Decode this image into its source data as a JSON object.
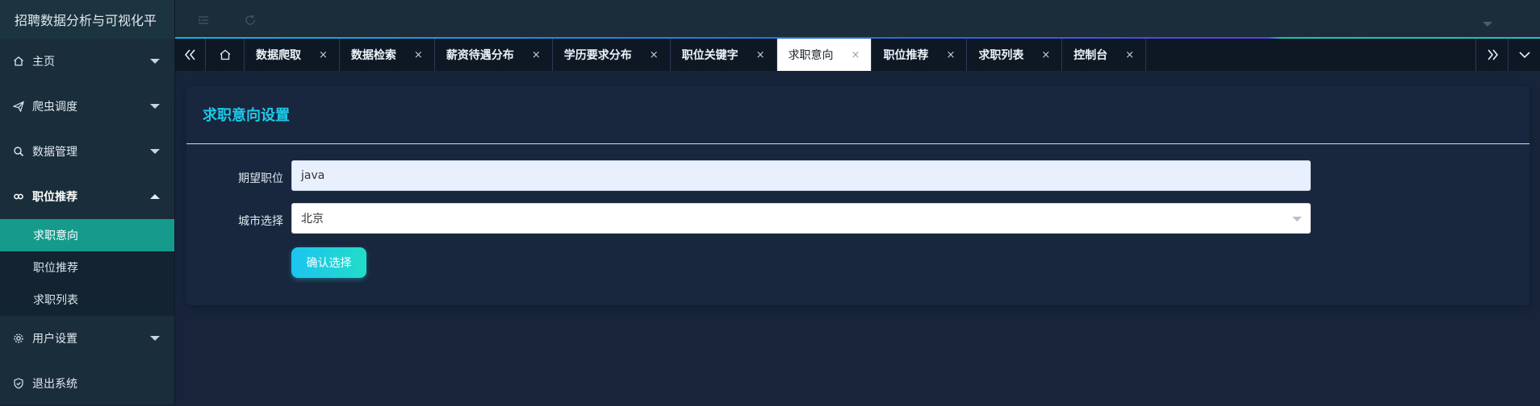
{
  "app": {
    "title": "招聘数据分析与可视化平"
  },
  "sidebar": {
    "items": [
      {
        "label": "主页",
        "icon": "home-icon"
      },
      {
        "label": "爬虫调度",
        "icon": "send-icon"
      },
      {
        "label": "数据管理",
        "icon": "search-icon"
      },
      {
        "label": "职位推荐",
        "icon": "link-icon"
      }
    ],
    "submenu": [
      {
        "label": "求职意向"
      },
      {
        "label": "职位推荐"
      },
      {
        "label": "求职列表"
      }
    ],
    "bottom_items": [
      {
        "label": "用户设置",
        "icon": "gear-icon"
      },
      {
        "label": "退出系统",
        "icon": "shield-icon"
      }
    ]
  },
  "tabs": [
    {
      "label": "数据爬取",
      "close": "×"
    },
    {
      "label": "数据检索",
      "close": "×"
    },
    {
      "label": "薪资待遇分布",
      "close": "×"
    },
    {
      "label": "学历要求分布",
      "close": "×"
    },
    {
      "label": "职位关键字",
      "close": "×"
    },
    {
      "label": "求职意向",
      "close": "×"
    },
    {
      "label": "职位推荐",
      "close": "×"
    },
    {
      "label": "求职列表",
      "close": "×"
    },
    {
      "label": "控制台",
      "close": "×"
    }
  ],
  "card": {
    "title": "求职意向设置",
    "position_label": "期望职位",
    "position_value": "java",
    "city_label": "城市选择",
    "city_value": "北京",
    "confirm_label": "确认选择"
  },
  "colors": {
    "accent": "#1ec8e8",
    "active_menu": "#159a8c"
  }
}
